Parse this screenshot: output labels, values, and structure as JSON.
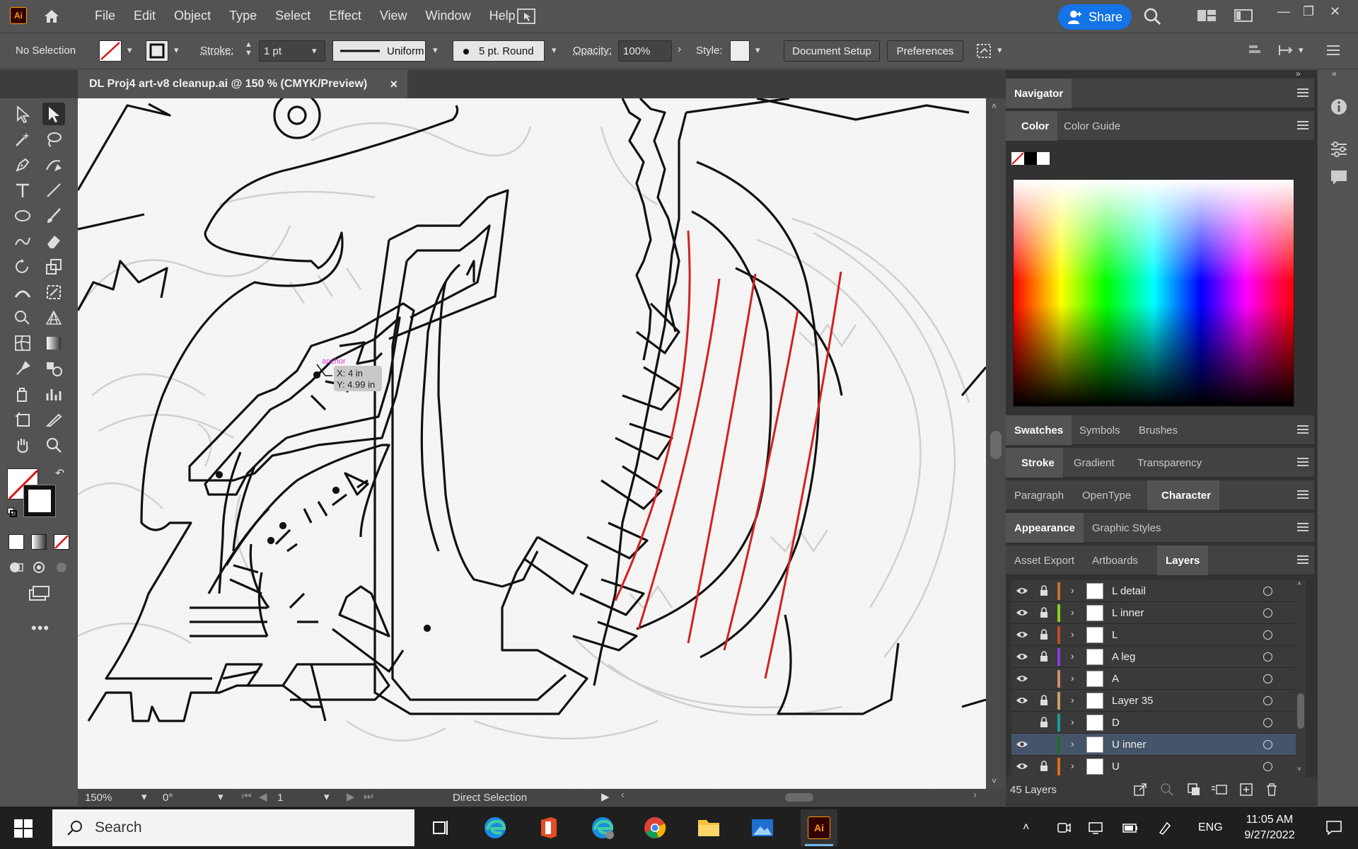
{
  "app": {
    "logo": "Ai",
    "menus": [
      "File",
      "Edit",
      "Object",
      "Type",
      "Select",
      "Effect",
      "View",
      "Window",
      "Help"
    ],
    "share_label": "Share"
  },
  "control_bar": {
    "selection": "No Selection",
    "stroke_label": "Stroke:",
    "stroke_weight": "1 pt",
    "profile": "Uniform",
    "brush": "5 pt. Round",
    "opacity_label": "Opacity:",
    "opacity_value": "100%",
    "style_label": "Style:",
    "document_setup": "Document Setup",
    "preferences": "Preferences"
  },
  "document": {
    "tab_title": "DL Proj4 art-v8 cleanup.ai @ 150 % (CMYK/Preview)",
    "close_glyph": "×"
  },
  "canvas": {
    "cursor_label": "anchor",
    "readout_x": "X: 4 in",
    "readout_y": "Y: 4.99 in"
  },
  "status_bar": {
    "zoom": "150%",
    "rotation": "0°",
    "artboard": "1",
    "tool": "Direct Selection"
  },
  "panels": {
    "navigator": "Navigator",
    "color_tabs": [
      "Color",
      "Color Guide"
    ],
    "swatch_tabs": [
      "Swatches",
      "Symbols",
      "Brushes"
    ],
    "stroke_tabs": [
      "Stroke",
      "Gradient",
      "Transparency"
    ],
    "char_tabs": [
      "Paragraph",
      "OpenType",
      "Character"
    ],
    "appearance_tabs": [
      "Appearance",
      "Graphic Styles"
    ],
    "layers_tabs": [
      "Asset Export",
      "Artboards",
      "Layers"
    ],
    "layer_count": "45 Layers"
  },
  "layers": [
    {
      "name": "L detail",
      "color": "#c8702a",
      "visible": true,
      "locked": true,
      "selected": false
    },
    {
      "name": "L inner",
      "color": "#8bd11c",
      "visible": true,
      "locked": true,
      "selected": false
    },
    {
      "name": "L",
      "color": "#c44a1e",
      "visible": true,
      "locked": true,
      "selected": false
    },
    {
      "name": "A leg",
      "color": "#8b39e6",
      "visible": true,
      "locked": true,
      "selected": false
    },
    {
      "name": "A",
      "color": "#d28a6a",
      "visible": true,
      "locked": false,
      "selected": false
    },
    {
      "name": "Layer 35",
      "color": "#c9a06a",
      "visible": true,
      "locked": true,
      "selected": false
    },
    {
      "name": "D",
      "color": "#1b9c9a",
      "visible": false,
      "locked": true,
      "selected": false
    },
    {
      "name": "U inner",
      "color": "#1f6e1f",
      "visible": true,
      "locked": false,
      "selected": true
    },
    {
      "name": "U",
      "color": "#e06b1a",
      "visible": true,
      "locked": true,
      "selected": false
    }
  ],
  "taskbar": {
    "search_placeholder": "Search",
    "language": "ENG",
    "time": "11:05 AM",
    "date": "9/27/2022"
  }
}
